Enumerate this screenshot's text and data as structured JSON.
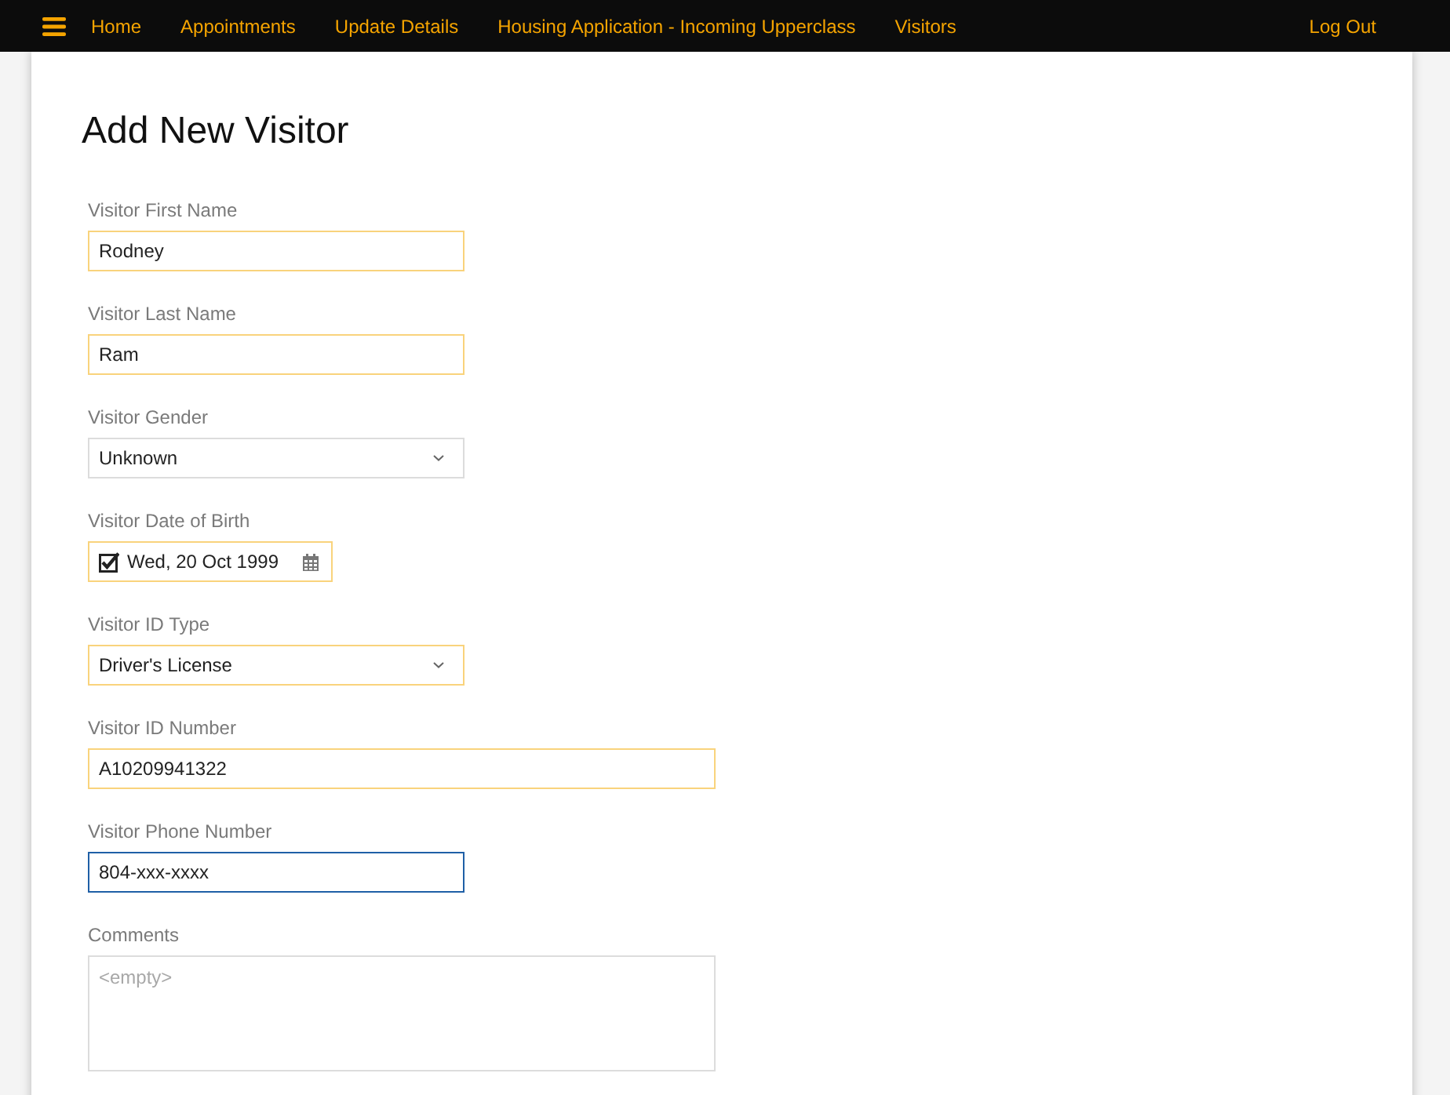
{
  "nav": {
    "items": [
      {
        "label": "Home"
      },
      {
        "label": "Appointments"
      },
      {
        "label": "Update Details"
      },
      {
        "label": "Housing Application - Incoming Upperclass"
      },
      {
        "label": "Visitors"
      }
    ],
    "logout": "Log Out"
  },
  "title": "Add New Visitor",
  "fields": [
    {
      "kind": "text",
      "label": "Visitor First Name",
      "value": "Rodney",
      "required": true,
      "focused": false
    },
    {
      "kind": "text",
      "label": "Visitor Last Name",
      "value": "Ram",
      "required": true,
      "focused": false
    },
    {
      "kind": "select",
      "label": "Visitor Gender",
      "value": "Unknown",
      "required": false,
      "focused": false
    },
    {
      "kind": "date",
      "label": "Visitor Date of Birth",
      "value": "Wed, 20 Oct 1999",
      "checked": true,
      "required": true,
      "focused": false
    },
    {
      "kind": "select",
      "label": "Visitor ID Type",
      "value": "Driver's License",
      "required": true,
      "focused": false
    },
    {
      "kind": "wide-text",
      "label": "Visitor ID Number",
      "value": "A10209941322",
      "required": true,
      "focused": false
    },
    {
      "kind": "text",
      "label": "Visitor Phone Number",
      "value": "804-xxx-xxxx",
      "required": false,
      "focused": true
    },
    {
      "kind": "textarea",
      "label": "Comments",
      "placeholder": "<empty>",
      "required": false,
      "focused": false
    }
  ]
}
